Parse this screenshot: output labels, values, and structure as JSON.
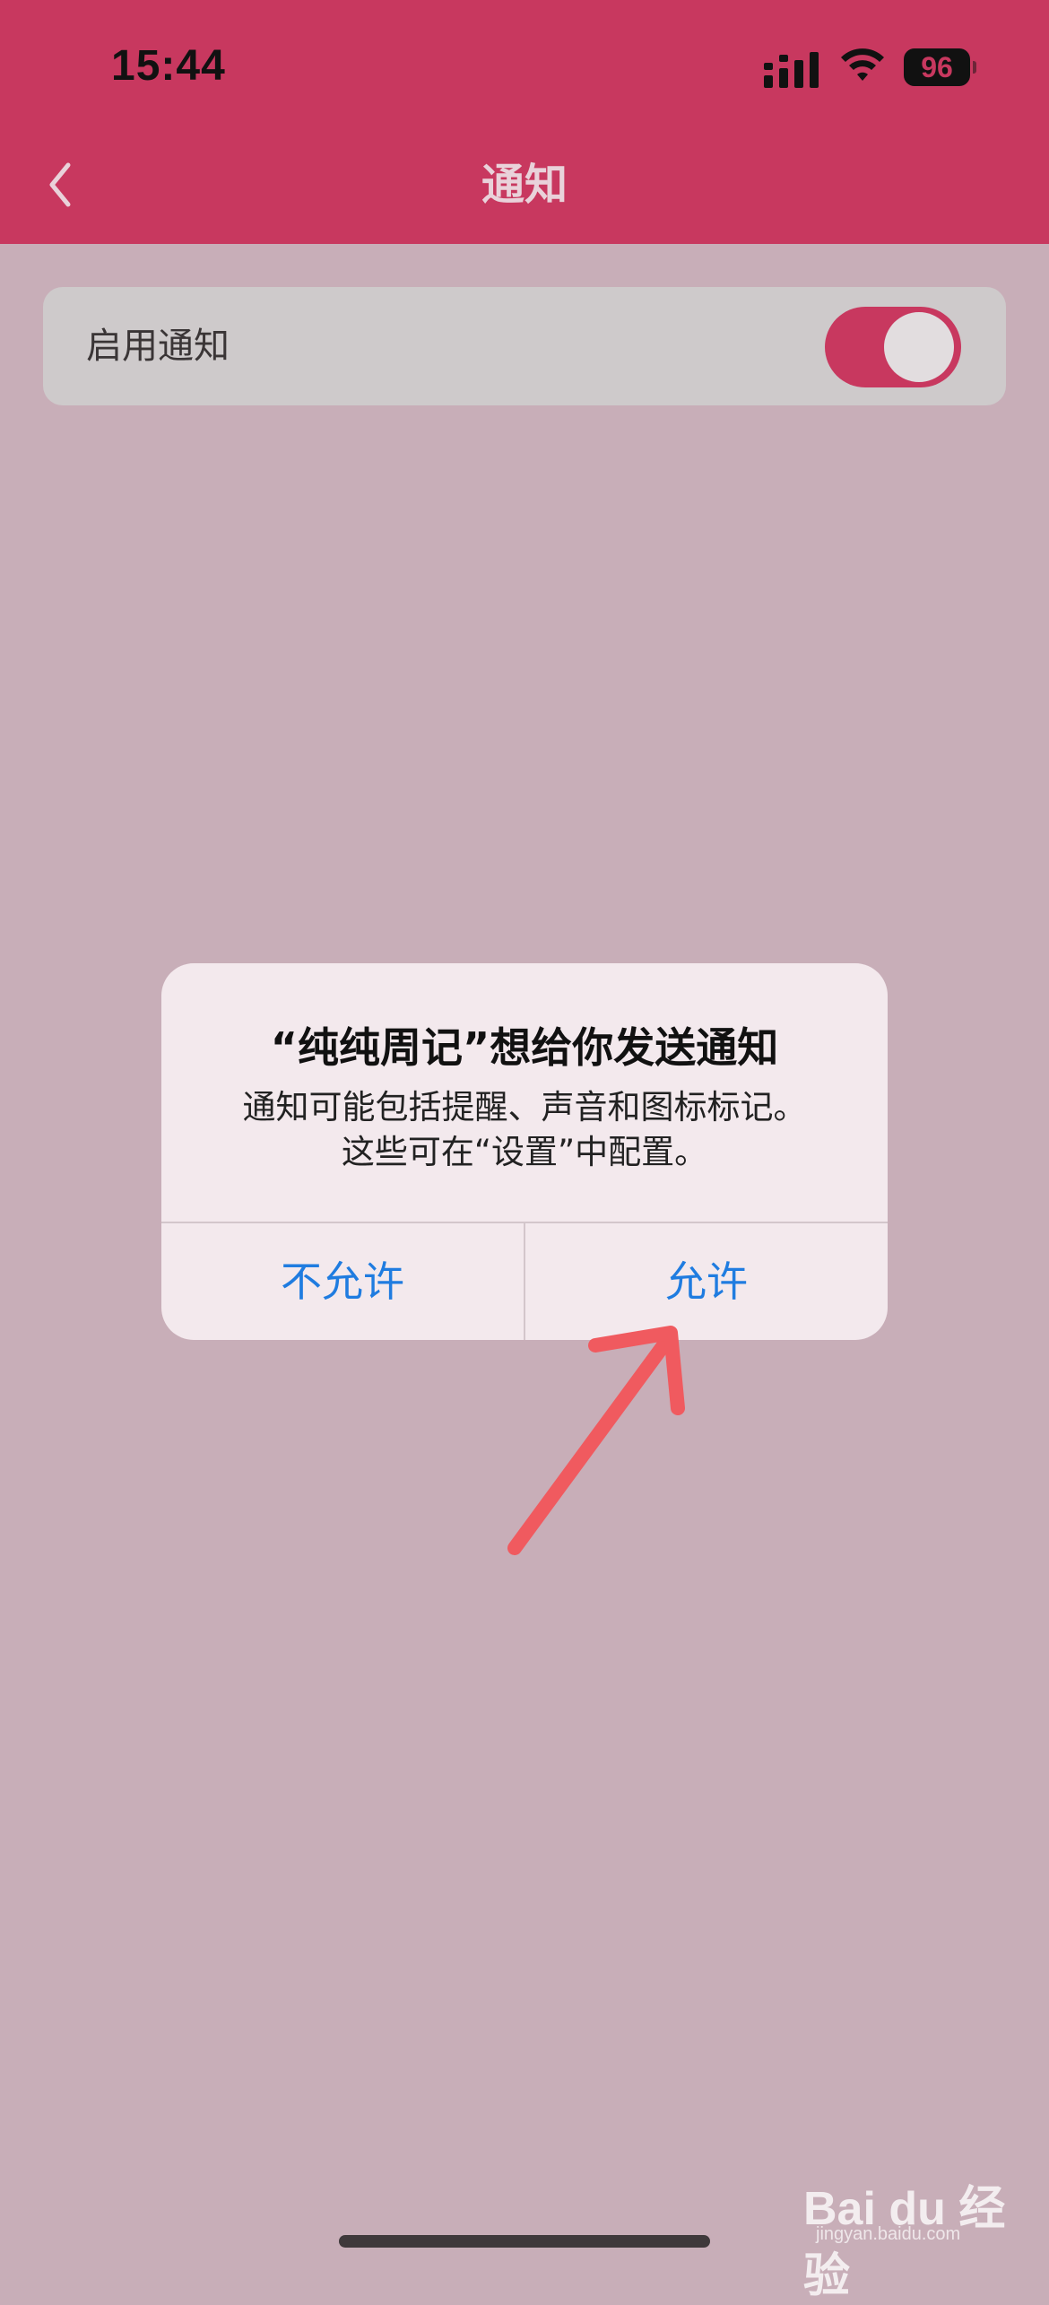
{
  "status_bar": {
    "time": "15:44",
    "battery": "96",
    "signal_icon": "signal-bars-icon",
    "wifi_icon": "wifi-icon"
  },
  "nav": {
    "title": "通知",
    "back_icon": "chevron-left-icon"
  },
  "settings": {
    "enable_notifications_label": "启用通知",
    "enable_notifications_on": true
  },
  "alert": {
    "title": "“纯纯周记”想给你发送通知",
    "message_line1": "通知可能包括提醒、声音和图标标记。",
    "message_line2": "这些可在“设置”中配置。",
    "deny_label": "不允许",
    "allow_label": "允许"
  },
  "watermark": {
    "brand": "Bai du 经验",
    "url": "jingyan.baidu.com"
  },
  "colors": {
    "accent": "#c8385f",
    "button_blue": "#1f7ce0",
    "annotation_arrow": "#f05a5f"
  }
}
